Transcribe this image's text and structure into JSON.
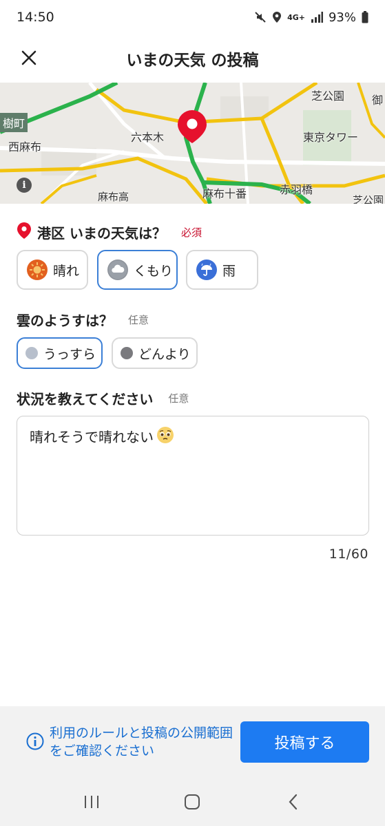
{
  "status_bar": {
    "time": "14:50",
    "network": "4G+",
    "battery": "93%"
  },
  "header": {
    "title": "いまの天気 の投稿",
    "close_icon": "close-icon"
  },
  "map": {
    "labels": {
      "shiba_koen": "芝公園",
      "on": "御",
      "itsuki_cho": "樹町",
      "roppongi": "六本木",
      "tokyo_tower": "東京タワー",
      "nishiazabu": "西麻布",
      "azabu_juban": "麻布十番",
      "akabanebashi": "赤羽橋",
      "azabu_ko": "麻布高",
      "shiba_koen_2": "芝公園"
    },
    "colors": {
      "road_major": "#f2c30f",
      "road_green": "#2bb24c",
      "pin": "#e6112d"
    }
  },
  "weather_section": {
    "title": "港区 いまの天気は？",
    "required": "必須",
    "options": [
      {
        "label": "晴れ",
        "icon": "sun-icon",
        "selected": false
      },
      {
        "label": "くもり",
        "icon": "cloud-icon",
        "selected": true
      },
      {
        "label": "雨",
        "icon": "umbrella-icon",
        "selected": false
      }
    ]
  },
  "cloud_section": {
    "title": "雲のようすは？",
    "optional": "任意",
    "options": [
      {
        "label": "うっすら",
        "selected": true,
        "color": "#b7bfcc"
      },
      {
        "label": "どんより",
        "selected": false,
        "color": "#7a7a7e"
      }
    ]
  },
  "comment_section": {
    "title": "状況を教えてください",
    "optional": "任意",
    "value": "晴れそうで晴れない",
    "counter": "11/60"
  },
  "footer": {
    "info_text": "利用のルールと投稿の公開範囲をご確認ください",
    "submit_label": "投稿する"
  }
}
